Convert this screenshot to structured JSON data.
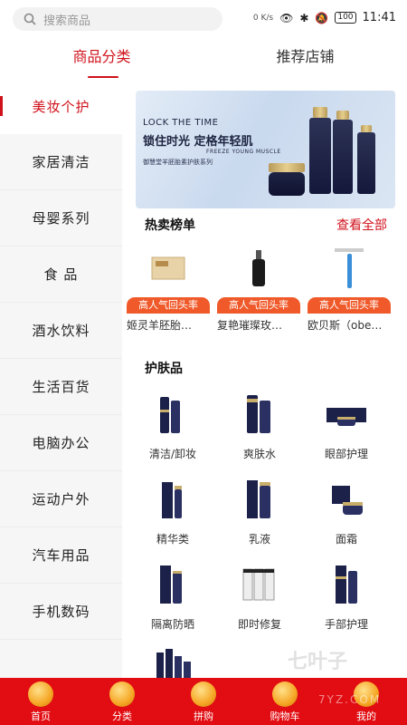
{
  "status": {
    "search_placeholder": "搜索商品",
    "net_speed": "0 K/s",
    "battery": "100",
    "time": "11:41"
  },
  "tabs": [
    {
      "label": "商品分类",
      "active": true
    },
    {
      "label": "推荐店铺",
      "active": false
    }
  ],
  "sidebar": {
    "items": [
      {
        "label": "美妆个护",
        "active": true
      },
      {
        "label": "家居清洁"
      },
      {
        "label": "母婴系列"
      },
      {
        "label": "食 品"
      },
      {
        "label": "酒水饮料"
      },
      {
        "label": "生活百货"
      },
      {
        "label": "电脑办公"
      },
      {
        "label": "运动户外"
      },
      {
        "label": "汽车用品"
      },
      {
        "label": "手机数码"
      }
    ]
  },
  "banner": {
    "line1": "LOCK THE TIME",
    "line2": "锁住时光 定格年轻肌",
    "line3": "FREEZE YOUNG MUSCLE",
    "line4": "御慧堂羊胚胎素护肤系列"
  },
  "hot": {
    "title": "热卖榜单",
    "see_all": "查看全部",
    "items": [
      {
        "badge": "高人气回头率",
        "name": "姬灵羊胚胎…"
      },
      {
        "badge": "高人气回头率",
        "name": "复艳璀璨玫…"
      },
      {
        "badge": "高人气回头率",
        "name": "欧贝斯（obe…"
      }
    ]
  },
  "skincare": {
    "title": "护肤品",
    "items": [
      {
        "label": "清洁/卸妆"
      },
      {
        "label": "爽肤水"
      },
      {
        "label": "眼部护理"
      },
      {
        "label": "精华类"
      },
      {
        "label": "乳液"
      },
      {
        "label": "面霜"
      },
      {
        "label": "隔离防晒"
      },
      {
        "label": "即时修复"
      },
      {
        "label": "手部护理"
      }
    ]
  },
  "bottom_nav": [
    {
      "label": "首页"
    },
    {
      "label": "分类",
      "active": true
    },
    {
      "label": "拼购"
    },
    {
      "label": "购物车"
    },
    {
      "label": "我的"
    }
  ],
  "watermark": {
    "brand": "七叶子",
    "site": "7YZ.COM"
  },
  "colors": {
    "accent": "#d0111b",
    "nav_bg": "#e10d12",
    "badge": "#f05a2a",
    "sidebar_bg": "#f6f6f6"
  }
}
